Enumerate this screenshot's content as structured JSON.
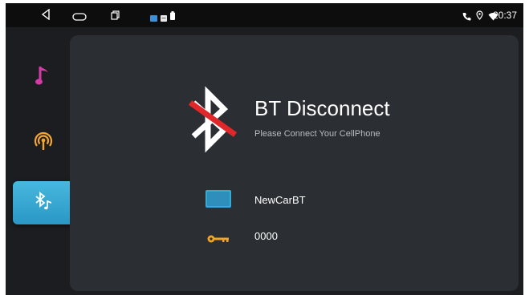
{
  "status_bar": {
    "nav_icons": [
      "back-icon",
      "home-icon",
      "recent-apps-icon"
    ],
    "notification_icons": [
      "app-notification-icon",
      "message-icon",
      "battery-icon"
    ],
    "right_icons": [
      "phone-icon",
      "location-icon",
      "wifi-icon"
    ],
    "time": "20:37"
  },
  "sidebar": {
    "items": [
      {
        "icon": "music-note-icon",
        "active": false
      },
      {
        "icon": "radio-broadcast-icon",
        "active": false
      },
      {
        "icon": "bluetooth-music-icon",
        "active": true
      }
    ]
  },
  "main": {
    "status_icon": "bluetooth-disconnected-icon",
    "title": "BT Disconnect",
    "subtitle": "Please Connect Your CellPhone",
    "device_name": "NewCarBT",
    "pin": "0000"
  },
  "colors": {
    "accent_blue": "#3aa9d6",
    "music_pink": "#d63aa8",
    "radio_orange": "#f2a531",
    "key_gold": "#f0a623",
    "disconnect_red": "#e0282a"
  }
}
